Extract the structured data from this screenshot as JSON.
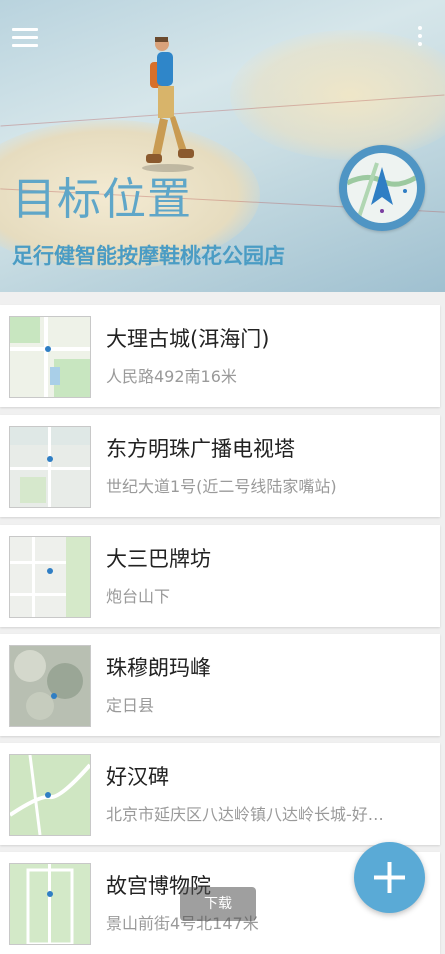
{
  "header": {
    "title": "目标位置",
    "subtitle": "足行健智能按摩鞋桃花公园店"
  },
  "places": [
    {
      "name": "大理古城(洱海门)",
      "address": "人民路492南16米"
    },
    {
      "name": "东方明珠广播电视塔",
      "address": "世纪大道1号(近二号线陆家嘴站)"
    },
    {
      "name": "大三巴牌坊",
      "address": "炮台山下"
    },
    {
      "name": "珠穆朗玛峰",
      "address": "定日县"
    },
    {
      "name": "好汉碑",
      "address": "北京市延庆区八达岭镇八达岭长城-好…"
    },
    {
      "name": "故宫博物院",
      "address": "景山前街4号北147米"
    }
  ],
  "toast": {
    "text": "下载"
  },
  "colors": {
    "accent": "#5aaad6",
    "title": "#5fa6c8"
  },
  "icons": {
    "menu": "hamburger-menu-icon",
    "more": "more-vert-icon",
    "fab": "plus-icon",
    "compass": "compass-icon"
  }
}
